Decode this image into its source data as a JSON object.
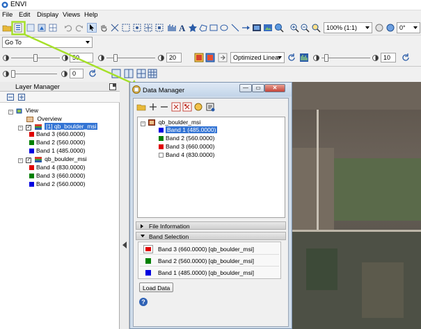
{
  "app": {
    "title": "ENVI"
  },
  "menu": [
    "File",
    "Edit",
    "Display",
    "Views",
    "Help"
  ],
  "toolbar": {
    "zoom": "100% (1:1)",
    "rotation": "0°",
    "goto": "Go To"
  },
  "controls": {
    "brightness": "50",
    "contrast": "20",
    "stretch": "Optimized Linear",
    "sharpen": "10",
    "transparency": "0"
  },
  "layer_manager": {
    "title": "Layer Manager",
    "view_label": "View",
    "overview_label": "Overview",
    "layer1": {
      "name": "[1] qb_boulder_msi",
      "bands": [
        "Band 3 (660.0000)",
        "Band 2 (560.0000)",
        "Band 1 (485.0000)"
      ]
    },
    "layer2": {
      "name": "qb_boulder_msi",
      "bands": [
        "Band 4 (830.0000)",
        "Band 3 (660.0000)",
        "Band 2 (560.0000)"
      ]
    }
  },
  "data_manager": {
    "title": "Data Manager",
    "file": "qb_boulder_msi",
    "bands": [
      "Band 1 (485.0000)",
      "Band 2 (560.0000)",
      "Band 3 (660.0000)",
      "Band 4 (830.0000)"
    ],
    "file_info_label": "File Information",
    "band_selection_label": "Band Selection",
    "selection": [
      "Band 3 (660.0000) [qb_boulder_msi]",
      "Band 2 (560.0000) [qb_boulder_msi]",
      "Band 1 (485.0000) [qb_boulder_msi]"
    ],
    "load_button": "Load Data",
    "help": "?"
  },
  "colors": {
    "red": "#e00000",
    "green": "#008000",
    "blue": "#0000e0",
    "highlight": "#a6e02a"
  }
}
